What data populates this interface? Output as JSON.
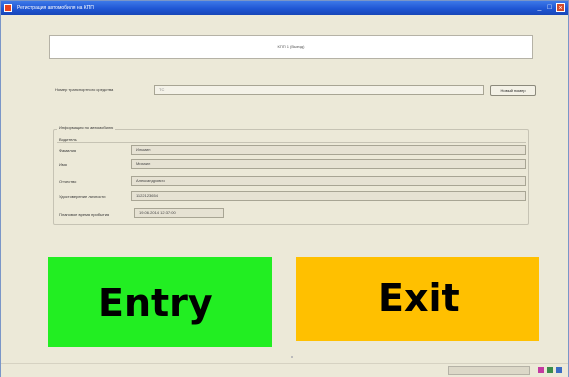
{
  "window": {
    "title": "Регистрация автомобиля на КПП",
    "app_icon": "app-logo-icon",
    "controls": {
      "minimize": "_",
      "maximize": "□",
      "close": "×"
    }
  },
  "header": {
    "text": "КПП 1 (Выезд)"
  },
  "vehicle": {
    "plate_label": "Номер транспортного средства",
    "plate_value": "",
    "plate_placeholder": "ТС",
    "new_number_label": "Новый номер"
  },
  "car_info": {
    "group_title": "Информация по автомобилю",
    "driver_title": "Водитель",
    "fields": [
      {
        "label": "Фамилия",
        "value": "Ильмин"
      },
      {
        "label": "Имя",
        "value": "Михаил"
      },
      {
        "label": "Отчество",
        "value": "Александрович"
      },
      {
        "label": "Удостоверение личности",
        "value": "1122123654"
      }
    ],
    "arrival_label": "Плановое время прибытия",
    "arrival_value": "19.06.2014 12:37:00"
  },
  "actions": {
    "entry_label": "Entry",
    "exit_label": "Exit"
  },
  "status_bar": {
    "tray_icons": [
      "tray-icon-1",
      "tray-icon-2",
      "tray-icon-3"
    ]
  },
  "colors": {
    "entry": "#22ee22",
    "exit": "#ffc000",
    "titlebar": "#1f56d4",
    "window": "#ece9d8"
  }
}
